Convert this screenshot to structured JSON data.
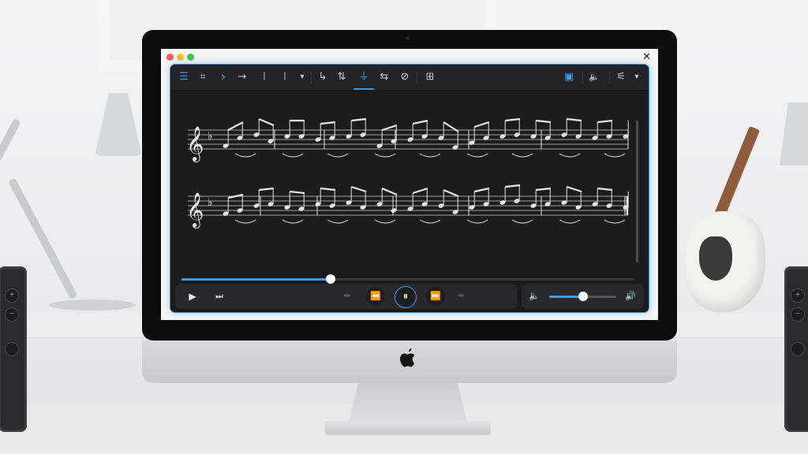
{
  "window": {
    "close_glyph": "✕"
  },
  "toolbar": {
    "items": [
      {
        "name": "menu-icon",
        "glyph": "☰"
      },
      {
        "name": "crop-frame-icon",
        "glyph": "⌗"
      },
      {
        "name": "chevron-right-icon",
        "glyph": "›"
      },
      {
        "name": "arrow-right-icon",
        "glyph": "→"
      },
      {
        "name": "selection-icon",
        "glyph": "⁞"
      },
      {
        "name": "dropdown-arrow-icon",
        "glyph": "▾"
      },
      {
        "name": "tie-icon",
        "glyph": "↳"
      },
      {
        "name": "transpose-icon",
        "glyph": "⇅"
      },
      {
        "name": "metronome-icon",
        "glyph": "⏚"
      },
      {
        "name": "mixer-icon",
        "glyph": "⇆"
      },
      {
        "name": "zoom-icon",
        "glyph": "⊘"
      },
      {
        "name": "grid-icon",
        "glyph": "⊞"
      },
      {
        "name": "panel-icon",
        "glyph": "▣"
      },
      {
        "name": "speaker-icon",
        "glyph": "🔈"
      },
      {
        "name": "settings-icon",
        "glyph": "⚟"
      }
    ]
  },
  "playback": {
    "progress": 0.33,
    "play_glyph": "▶",
    "next_glyph": "⏭",
    "rewind_glyph": "⏪",
    "pause_glyph": "⏸",
    "forward_glyph": "⏩",
    "shuffle_glyph": "⇹",
    "repeat_glyph": "⇸"
  },
  "volume": {
    "level": 0.5,
    "low_glyph": "🔈",
    "high_glyph": "🔊"
  },
  "colors": {
    "accent": "#3d9bf0",
    "app_bg": "#1b1b1c"
  }
}
